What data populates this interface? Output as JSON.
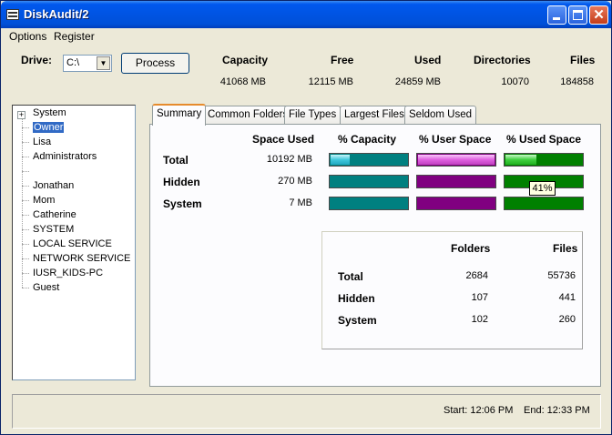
{
  "window": {
    "title": "DiskAudit/2"
  },
  "menu": {
    "options": "Options",
    "register": "Register"
  },
  "drive": {
    "label": "Drive:",
    "value": "C:\\"
  },
  "process_label": "Process",
  "stats": {
    "headers": [
      "Capacity",
      "Free",
      "Used",
      "Directories",
      "Files"
    ],
    "values": [
      "41068 MB",
      "12115 MB",
      "24859 MB",
      "10070",
      "184858"
    ]
  },
  "tree": {
    "items": [
      "System",
      "Owner",
      "Lisa",
      "Administrators",
      "",
      "Jonathan",
      "Mom",
      "Catherine",
      "SYSTEM",
      "LOCAL SERVICE",
      "NETWORK SERVICE",
      "IUSR_KIDS-PC",
      "Guest"
    ],
    "selected": "Owner",
    "expander": "+"
  },
  "tabs": [
    "Summary",
    "Common Folders",
    "File Types",
    "Largest Files",
    "Seldom Used"
  ],
  "summary": {
    "headers": [
      "Space Used",
      "% Capacity",
      "% User Space",
      "% Used Space"
    ],
    "rows": [
      {
        "label": "Total",
        "space": "10192 MB",
        "capacity": 0.25,
        "user_space": 1.0,
        "used_space": 0.41
      },
      {
        "label": "Hidden",
        "space": "270 MB",
        "capacity": 0.0,
        "user_space": 0.0,
        "used_space": 0.0
      },
      {
        "label": "System",
        "space": "7 MB",
        "capacity": 0.0,
        "user_space": 0.0,
        "used_space": 0.0
      }
    ],
    "tooltip": "41%"
  },
  "folders_files": {
    "headers": [
      "Folders",
      "Files"
    ],
    "rows": [
      {
        "label": "Total",
        "folders": "2684",
        "files": "55736"
      },
      {
        "label": "Hidden",
        "folders": "107",
        "files": "441"
      },
      {
        "label": "System",
        "folders": "102",
        "files": "260"
      }
    ]
  },
  "status": {
    "start": "Start: 12:06 PM",
    "end": "End: 12:33 PM"
  },
  "colors": {
    "title_bar": "#0054e3",
    "selection": "#316ac5",
    "bar_teal": "#008080",
    "bar_purple": "#800080",
    "bar_green": "#008000",
    "tab_accent": "#e68b2c"
  }
}
